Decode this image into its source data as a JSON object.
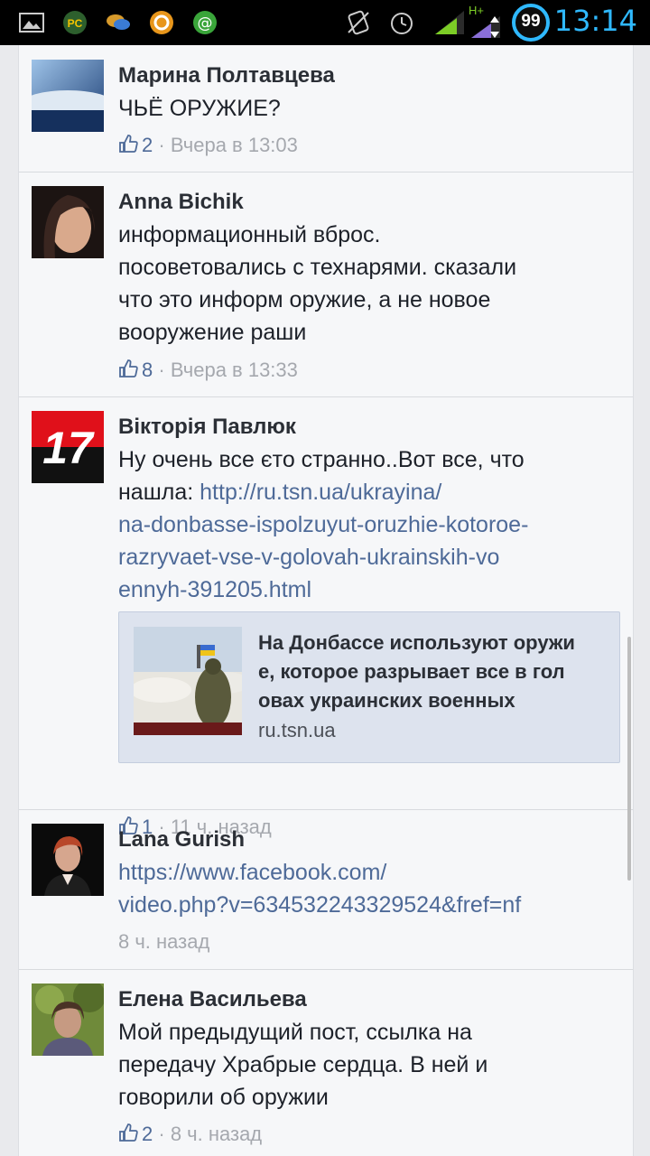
{
  "statusbar": {
    "time": "13:14",
    "battery": "99",
    "network": "H+",
    "icons": [
      "gallery-icon",
      "pc-app-icon",
      "chat-app-icon",
      "ok-app-icon",
      "at-app-icon",
      "no-sound-icon",
      "alarm-icon",
      "signal-icon",
      "data-arrows-icon",
      "battery-icon"
    ]
  },
  "comments": [
    {
      "author": "Марина Полтавцева",
      "text": "ЧЬЁ ОРУЖИЕ?",
      "likes": "2",
      "time": "· Вчера в 13:03"
    },
    {
      "author": "Anna Bichik",
      "text_lines": [
        "информационный вброс.",
        "посоветовались с технарями. сказали",
        "что это информ оружие, а не новое",
        "вооружение раши"
      ],
      "likes": "8",
      "time": "· Вчера в 13:33"
    },
    {
      "author": "Вікторія Павлюк",
      "avatar_text": "17",
      "text_prefix": "Ну очень все єто странно..Вот все, что",
      "text_prefix2": "нашла: ",
      "link_lines": [
        "http://ru.tsn.ua/ukrayina/",
        "na-donbasse-ispolzuyut-oruzhie-kotoroe-",
        "razryvaet-vse-v-golovah-ukrainskih-vo",
        "ennyh-391205.html"
      ],
      "preview": {
        "title_lines": [
          "На Донбассе используют оружи",
          "е, которое разрывает все в гол",
          "овах украинских военных"
        ],
        "domain": "ru.tsn.ua"
      },
      "likes": "1",
      "time": "· 11 ч. назад"
    },
    {
      "author": "Lana Gurish",
      "link_lines": [
        "https://www.facebook.com/",
        "video.php?v=634532243329524&fref=nf"
      ],
      "time": "8 ч. назад"
    },
    {
      "author": "Елена Васильева",
      "text_lines": [
        "Мой предыдущий пост, ссылка на",
        "передачу Храбрые сердца. В ней и",
        "говорили об оружии"
      ],
      "likes": "2",
      "time": "· 8 ч. назад"
    }
  ],
  "colors": {
    "link": "#4e6a98",
    "meta": "#a5a8ae",
    "status_time": "#2fb9ff",
    "background": "#f6f7f9"
  }
}
